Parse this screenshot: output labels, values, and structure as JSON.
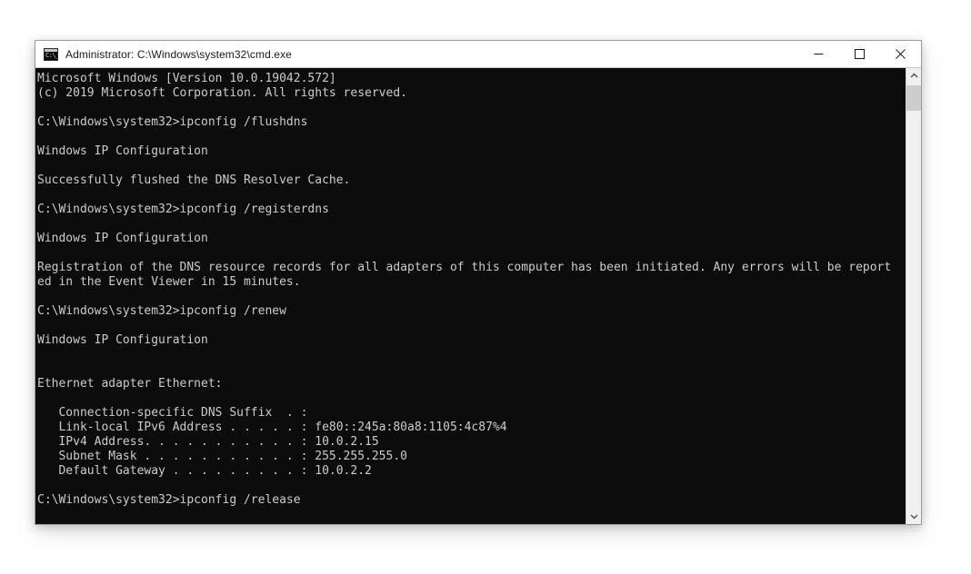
{
  "window": {
    "title": "Administrator: C:\\Windows\\system32\\cmd.exe",
    "icon": "console-icon",
    "icon_prompt_text": "C:\\_",
    "colors": {
      "terminal_background": "#0c0c0c",
      "terminal_foreground": "#cccccc",
      "titlebar_background": "#ffffff",
      "titlebar_foreground": "#1a1a1a",
      "window_border": "#9b9b9b",
      "scrollbar_track": "#f0f0f0",
      "scrollbar_thumb": "#cdcdcd",
      "close_hover": "#e81123"
    }
  },
  "titlebar_buttons": {
    "minimize": {
      "name": "minimize-button",
      "label": "Minimize"
    },
    "maximize": {
      "name": "maximize-button",
      "label": "Maximize"
    },
    "close": {
      "name": "close-button",
      "label": "Close"
    }
  },
  "scrollbar": {
    "up_arrow_label": "Scroll up",
    "down_arrow_label": "Scroll down",
    "thumb_label": "Scroll thumb",
    "thumb_top_percent": 0,
    "thumb_size_percent": 6
  },
  "terminal": {
    "prompt": "C:\\Windows\\system32>",
    "lines": [
      "Microsoft Windows [Version 10.0.19042.572]",
      "(c) 2019 Microsoft Corporation. All rights reserved.",
      "",
      "C:\\Windows\\system32>ipconfig /flushdns",
      "",
      "Windows IP Configuration",
      "",
      "Successfully flushed the DNS Resolver Cache.",
      "",
      "C:\\Windows\\system32>ipconfig /registerdns",
      "",
      "Windows IP Configuration",
      "",
      "Registration of the DNS resource records for all adapters of this computer has been initiated. Any errors will be report",
      "ed in the Event Viewer in 15 minutes.",
      "",
      "C:\\Windows\\system32>ipconfig /renew",
      "",
      "Windows IP Configuration",
      "",
      "",
      "Ethernet adapter Ethernet:",
      "",
      "   Connection-specific DNS Suffix  . : ",
      "   Link-local IPv6 Address . . . . . : fe80::245a:80a8:1105:4c87%4",
      "   IPv4 Address. . . . . . . . . . . : 10.0.2.15",
      "   Subnet Mask . . . . . . . . . . . : 255.255.255.0",
      "   Default Gateway . . . . . . . . . : 10.0.2.2",
      "",
      "C:\\Windows\\system32>ipconfig /release"
    ],
    "commands_run": [
      "ipconfig /flushdns",
      "ipconfig /registerdns",
      "ipconfig /renew",
      "ipconfig /release"
    ],
    "adapter": {
      "name": "Ethernet adapter Ethernet:",
      "connection_specific_dns_suffix": "",
      "link_local_ipv6_address": "fe80::245a:80a8:1105:4c87%4",
      "ipv4_address": "10.0.2.15",
      "subnet_mask": "255.255.255.0",
      "default_gateway": "10.0.2.2"
    }
  }
}
